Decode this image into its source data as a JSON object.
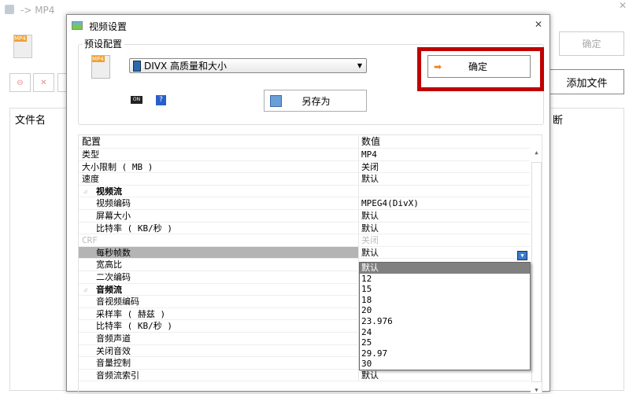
{
  "app": {
    "title": "-> MP4",
    "ok_label": "确定",
    "add_files_label": "添加文件",
    "file_name_header": "文件名",
    "col_fragment": "断"
  },
  "dialog": {
    "title": "视频设置",
    "preset_group_label": "预设配置",
    "preset_value": "DIVX 高质量和大小",
    "save_as_label": "另存为",
    "ok_label": "确定",
    "grid": {
      "headers": [
        "配置",
        "数值"
      ],
      "rows": [
        {
          "key": "类型",
          "value": "MP4",
          "type": "top"
        },
        {
          "key": "大小限制 ( MB )",
          "value": "关闭",
          "type": "top"
        },
        {
          "key": "速度",
          "value": "默认",
          "type": "top"
        },
        {
          "key": "视频流",
          "value": "",
          "type": "cat"
        },
        {
          "key": "视频编码",
          "value": "MPEG4(DivX)",
          "type": "sub"
        },
        {
          "key": "屏幕大小",
          "value": "默认",
          "type": "sub"
        },
        {
          "key": "比特率 ( KB/秒 )",
          "value": "默认",
          "type": "sub"
        },
        {
          "key": "CRF",
          "value": "关闭",
          "type": "dis"
        },
        {
          "key": "每秒帧数",
          "value": "默认",
          "type": "sel"
        },
        {
          "key": "宽高比",
          "value": "",
          "type": "sub"
        },
        {
          "key": "二次编码",
          "value": "",
          "type": "sub"
        },
        {
          "key": "音频流",
          "value": "",
          "type": "cat"
        },
        {
          "key": "音视频编码",
          "value": "",
          "type": "sub"
        },
        {
          "key": "采样率 ( 赫兹 )",
          "value": "",
          "type": "sub"
        },
        {
          "key": "比特率 ( KB/秒 )",
          "value": "",
          "type": "sub"
        },
        {
          "key": "音频声道",
          "value": "",
          "type": "sub"
        },
        {
          "key": "关闭音效",
          "value": "",
          "type": "sub"
        },
        {
          "key": "音量控制",
          "value": "",
          "type": "sub"
        },
        {
          "key": "音频流索引",
          "value": "默认",
          "type": "sub"
        }
      ],
      "dropdown_options": [
        "默认",
        "12",
        "15",
        "18",
        "20",
        "23.976",
        "24",
        "25",
        "29.97",
        "30"
      ],
      "dropdown_selected": "默认"
    }
  },
  "colors": {
    "highlight": "#c00000",
    "selected_row": "#b4b4b4",
    "selected_option": "#808080"
  }
}
